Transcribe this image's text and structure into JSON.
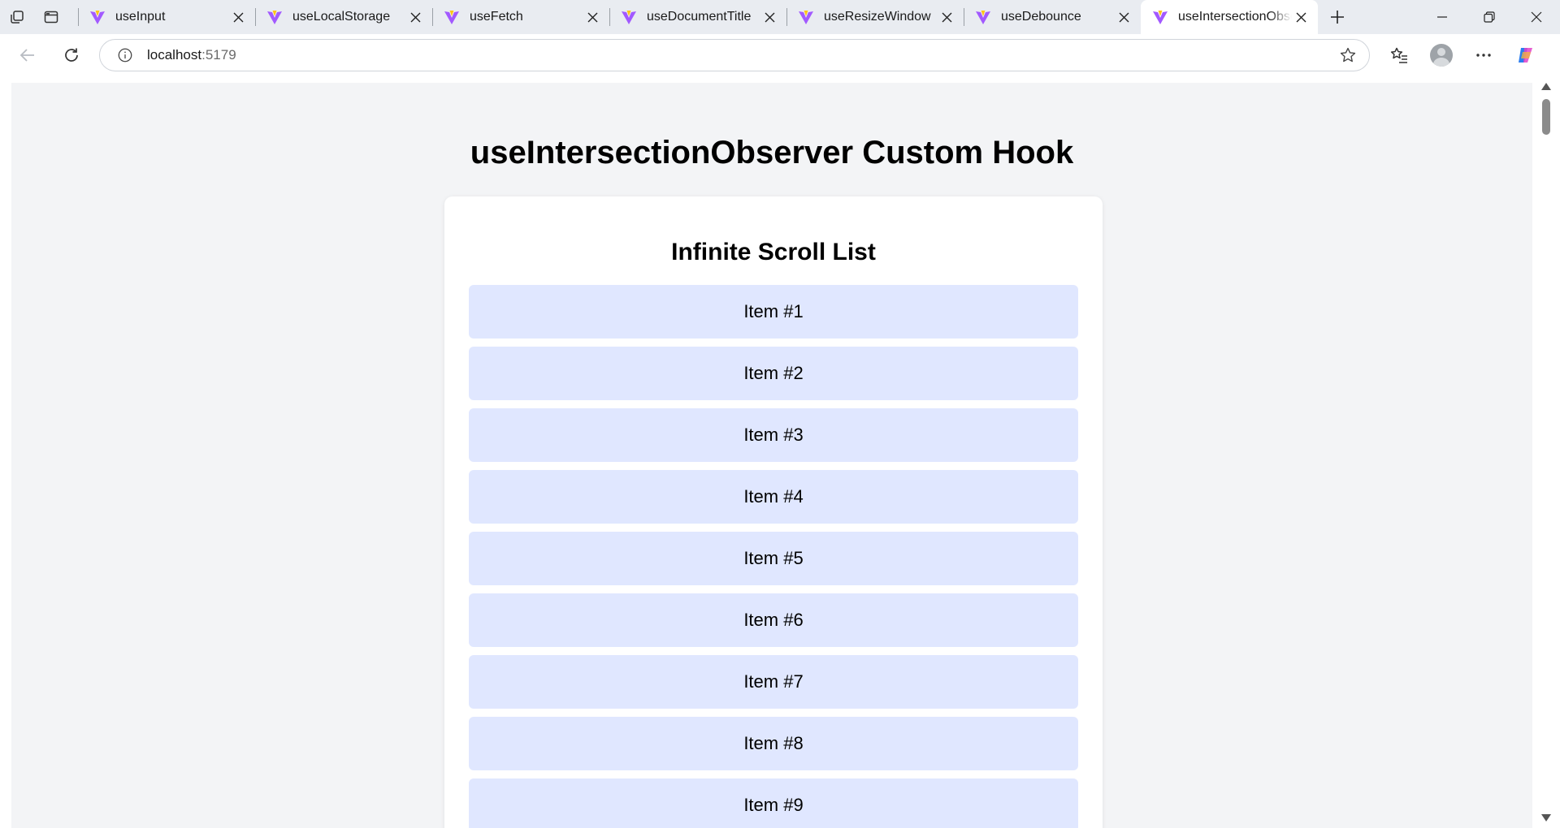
{
  "browser": {
    "tabs": [
      {
        "title": "useInput",
        "active": false
      },
      {
        "title": "useLocalStorage",
        "active": false
      },
      {
        "title": "useFetch",
        "active": false
      },
      {
        "title": "useDocumentTitle",
        "active": false
      },
      {
        "title": "useResizeWindow",
        "active": false
      },
      {
        "title": "useDebounce",
        "active": false
      },
      {
        "title": "useIntersectionObserver Custom Hook",
        "active": true
      }
    ],
    "address": {
      "host": "localhost",
      "port": ":5179"
    },
    "colors": {
      "favicon_purple": "#a259ff",
      "favicon_yellow": "#ffc517",
      "tabstrip": "#e9ecf1"
    }
  },
  "page": {
    "title": "useIntersectionObserver Custom Hook",
    "card_title": "Infinite Scroll List",
    "items": [
      "Item #1",
      "Item #2",
      "Item #3",
      "Item #4",
      "Item #5",
      "Item #6",
      "Item #7",
      "Item #8",
      "Item #9"
    ],
    "colors": {
      "background": "#f3f4f6",
      "card": "#ffffff",
      "item": "#e0e7ff"
    }
  },
  "icons": {
    "workspaces": "workspaces-icon",
    "tab_actions": "tab-actions-icon",
    "back": "back-arrow-icon",
    "refresh": "refresh-icon",
    "site_info": "info-icon",
    "favorite": "star-icon",
    "favorites": "favorites-icon",
    "profile": "profile-icon",
    "more": "more-icon",
    "copilot": "copilot-icon"
  }
}
